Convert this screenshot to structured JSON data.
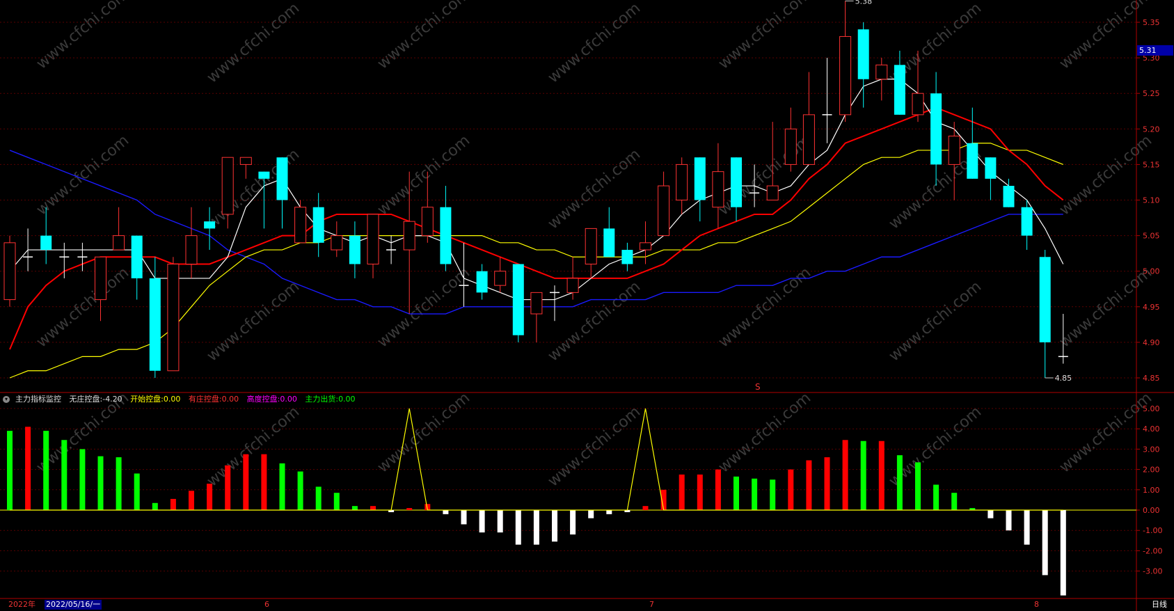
{
  "main": {
    "price_ticks": [
      "5.35",
      "5.30",
      "5.25",
      "5.20",
      "5.15",
      "5.10",
      "5.05",
      "5.00",
      "4.95",
      "4.90",
      "4.85"
    ],
    "current_price": "5.31",
    "max_label": "5.38",
    "min_label": "4.85",
    "s_marker": "S"
  },
  "indicator": {
    "title": "主力指标监控",
    "no_control": "无庄控盘:",
    "no_control_val": "-4.20",
    "start_control": "开始控盘:",
    "start_control_val": "0.00",
    "has_control": "有庄控盘:",
    "has_control_val": "0.00",
    "high_control": "高度控盘:",
    "high_control_val": "0.00",
    "main_out": "主力出货:",
    "main_out_val": "0.00",
    "ticks": [
      "5.00",
      "4.00",
      "3.00",
      "2.00",
      "1.00",
      "0.00",
      "-1.00",
      "-2.00",
      "-3.00"
    ]
  },
  "bottom": {
    "year": "2022年",
    "date": "2022/05/16/一",
    "months": [
      "6",
      "7",
      "8"
    ],
    "period": "日线"
  },
  "watermark": "www.cfchi.com",
  "colors": {
    "up": "#ff3232",
    "down": "#00ffff",
    "ma5": "#ffffff",
    "ma10": "#ff0000",
    "ma20": "#ffff00",
    "ma60": "#1a1aff"
  },
  "chart_data": [
    {
      "type": "candlestick",
      "ylim": [
        4.85,
        5.38
      ],
      "candles": [
        [
          4.96,
          5.04,
          5.05,
          4.95
        ],
        [
          5.02,
          5.02,
          5.06,
          5.0
        ],
        [
          5.05,
          5.03,
          5.09,
          5.01
        ],
        [
          5.02,
          5.02,
          5.04,
          4.99
        ],
        [
          5.02,
          5.02,
          5.04,
          5.0
        ],
        [
          4.96,
          5.02,
          5.02,
          4.93
        ],
        [
          5.03,
          5.05,
          5.09,
          5.03
        ],
        [
          5.05,
          4.99,
          5.05,
          4.96
        ],
        [
          4.99,
          4.86,
          5.02,
          4.85
        ],
        [
          4.86,
          5.01,
          5.02,
          4.86
        ],
        [
          5.01,
          5.05,
          5.09,
          4.99
        ],
        [
          5.07,
          5.06,
          5.09,
          5.03
        ],
        [
          5.08,
          5.16,
          5.16,
          5.06
        ],
        [
          5.15,
          5.16,
          5.16,
          5.13
        ],
        [
          5.14,
          5.13,
          5.14,
          5.06
        ],
        [
          5.16,
          5.1,
          5.16,
          5.06
        ],
        [
          5.04,
          5.09,
          5.1,
          5.04
        ],
        [
          5.09,
          5.04,
          5.11,
          5.02
        ],
        [
          5.03,
          5.05,
          5.07,
          5.02
        ],
        [
          5.05,
          5.01,
          5.07,
          4.99
        ],
        [
          5.01,
          5.08,
          5.08,
          4.99
        ],
        [
          5.03,
          5.03,
          5.05,
          5.01
        ],
        [
          5.03,
          5.07,
          5.14,
          4.94
        ],
        [
          5.05,
          5.09,
          5.14,
          5.04
        ],
        [
          5.09,
          5.01,
          5.12,
          5.0
        ],
        [
          4.98,
          4.98,
          5.04,
          4.95
        ],
        [
          5.0,
          4.97,
          5.01,
          4.96
        ],
        [
          4.98,
          5.0,
          5.02,
          4.97
        ],
        [
          5.01,
          4.91,
          5.01,
          4.9
        ],
        [
          4.94,
          4.97,
          4.97,
          4.9
        ],
        [
          4.97,
          4.97,
          4.98,
          4.93
        ],
        [
          4.97,
          4.99,
          5.02,
          4.96
        ],
        [
          5.01,
          5.06,
          5.06,
          4.99
        ],
        [
          5.06,
          5.02,
          5.09,
          5.02
        ],
        [
          5.03,
          5.01,
          5.04,
          5.0
        ],
        [
          5.03,
          5.04,
          5.07,
          5.01
        ],
        [
          5.05,
          5.12,
          5.14,
          5.05
        ],
        [
          5.1,
          5.15,
          5.16,
          5.08
        ],
        [
          5.16,
          5.1,
          5.16,
          5.07
        ],
        [
          5.09,
          5.14,
          5.18,
          5.06
        ],
        [
          5.16,
          5.09,
          5.16,
          5.07
        ],
        [
          5.11,
          5.11,
          5.15,
          5.09
        ],
        [
          5.1,
          5.12,
          5.21,
          5.1
        ],
        [
          5.15,
          5.2,
          5.23,
          5.14
        ],
        [
          5.15,
          5.22,
          5.28,
          5.15
        ],
        [
          5.22,
          5.22,
          5.3,
          5.18
        ],
        [
          5.22,
          5.33,
          5.38,
          5.21
        ],
        [
          5.34,
          5.27,
          5.35,
          5.23
        ],
        [
          5.27,
          5.29,
          5.3,
          5.24
        ],
        [
          5.29,
          5.22,
          5.31,
          5.22
        ],
        [
          5.22,
          5.25,
          5.31,
          5.21
        ],
        [
          5.25,
          5.15,
          5.28,
          5.12
        ],
        [
          5.15,
          5.19,
          5.21,
          5.1
        ],
        [
          5.18,
          5.13,
          5.23,
          5.13
        ],
        [
          5.16,
          5.13,
          5.16,
          5.1
        ],
        [
          5.12,
          5.09,
          5.13,
          5.09
        ],
        [
          5.09,
          5.05,
          5.1,
          5.03
        ],
        [
          5.02,
          4.9,
          5.03,
          4.85
        ],
        [
          4.88,
          4.88,
          4.94,
          4.87
        ]
      ],
      "ma5": [
        5.0,
        5.03,
        5.03,
        5.03,
        5.03,
        5.03,
        5.03,
        5.03,
        4.99,
        4.99,
        4.99,
        4.99,
        5.02,
        5.09,
        5.12,
        5.13,
        5.09,
        5.06,
        5.05,
        5.04,
        5.05,
        5.04,
        5.05,
        5.05,
        5.04,
        4.99,
        4.98,
        4.97,
        4.96,
        4.96,
        4.96,
        4.97,
        4.99,
        5.01,
        5.02,
        5.03,
        5.05,
        5.08,
        5.1,
        5.11,
        5.12,
        5.12,
        5.11,
        5.12,
        5.15,
        5.17,
        5.22,
        5.26,
        5.27,
        5.27,
        5.25,
        5.21,
        5.2,
        5.17,
        5.14,
        5.12,
        5.1,
        5.06,
        5.01
      ],
      "ma10": [
        4.89,
        4.95,
        4.98,
        5.0,
        5.01,
        5.02,
        5.02,
        5.02,
        5.02,
        5.01,
        5.01,
        5.01,
        5.02,
        5.03,
        5.04,
        5.05,
        5.05,
        5.07,
        5.08,
        5.08,
        5.08,
        5.08,
        5.07,
        5.06,
        5.05,
        5.04,
        5.03,
        5.02,
        5.01,
        5.0,
        4.99,
        4.99,
        4.99,
        4.99,
        4.99,
        5.0,
        5.01,
        5.03,
        5.05,
        5.06,
        5.07,
        5.08,
        5.08,
        5.1,
        5.13,
        5.15,
        5.18,
        5.19,
        5.2,
        5.21,
        5.22,
        5.23,
        5.22,
        5.21,
        5.2,
        5.17,
        5.15,
        5.12,
        5.1
      ],
      "ma20": [
        4.85,
        4.86,
        4.86,
        4.87,
        4.88,
        4.88,
        4.89,
        4.89,
        4.9,
        4.92,
        4.95,
        4.98,
        5.0,
        5.02,
        5.03,
        5.03,
        5.04,
        5.04,
        5.05,
        5.05,
        5.05,
        5.05,
        5.05,
        5.05,
        5.05,
        5.05,
        5.05,
        5.04,
        5.04,
        5.03,
        5.03,
        5.02,
        5.02,
        5.02,
        5.02,
        5.02,
        5.03,
        5.03,
        5.03,
        5.04,
        5.04,
        5.05,
        5.06,
        5.07,
        5.09,
        5.11,
        5.13,
        5.15,
        5.16,
        5.16,
        5.17,
        5.17,
        5.17,
        5.18,
        5.18,
        5.17,
        5.17,
        5.16,
        5.15
      ],
      "ma60": [
        5.17,
        5.16,
        5.15,
        5.14,
        5.13,
        5.12,
        5.11,
        5.1,
        5.08,
        5.07,
        5.06,
        5.05,
        5.03,
        5.02,
        5.01,
        4.99,
        4.98,
        4.97,
        4.96,
        4.96,
        4.95,
        4.95,
        4.94,
        4.94,
        4.94,
        4.95,
        4.95,
        4.95,
        4.95,
        4.95,
        4.95,
        4.95,
        4.96,
        4.96,
        4.96,
        4.96,
        4.97,
        4.97,
        4.97,
        4.97,
        4.98,
        4.98,
        4.98,
        4.99,
        4.99,
        5.0,
        5.0,
        5.01,
        5.02,
        5.02,
        5.03,
        5.04,
        5.05,
        5.06,
        5.07,
        5.08,
        5.08,
        5.08,
        5.08
      ]
    },
    {
      "type": "bar",
      "ylim": [
        -4.5,
        5.5
      ],
      "values": [
        3.9,
        4.1,
        3.9,
        3.45,
        3.0,
        2.65,
        2.6,
        1.8,
        0.35,
        0.55,
        0.95,
        1.3,
        2.2,
        2.75,
        2.75,
        2.3,
        1.9,
        1.15,
        0.85,
        0.2,
        0.2,
        -0.1,
        0.1,
        0.3,
        -0.2,
        -0.7,
        -1.1,
        -1.1,
        -1.7,
        -1.7,
        -1.55,
        -1.2,
        -0.4,
        -0.2,
        -0.1,
        0.2,
        1.0,
        1.75,
        1.75,
        2.0,
        1.65,
        1.55,
        1.5,
        2.0,
        2.45,
        2.6,
        3.45,
        3.4,
        3.4,
        2.7,
        2.35,
        1.25,
        0.85,
        0.1,
        -0.4,
        -1.0,
        -1.7,
        -3.2,
        -4.2
      ],
      "line_values": [
        0,
        0,
        0,
        0,
        0,
        0,
        0,
        0,
        0,
        0,
        0,
        0,
        0,
        0,
        0,
        0,
        0,
        0,
        0,
        0,
        0,
        0,
        5.0,
        0,
        0,
        0,
        0,
        0,
        0,
        0,
        0,
        0,
        0,
        0,
        0,
        5.0,
        0,
        0,
        0,
        0,
        0,
        0,
        0,
        0,
        0,
        0,
        0,
        0,
        0,
        0,
        0,
        0,
        0,
        0,
        0,
        0,
        0,
        0,
        0
      ]
    }
  ]
}
